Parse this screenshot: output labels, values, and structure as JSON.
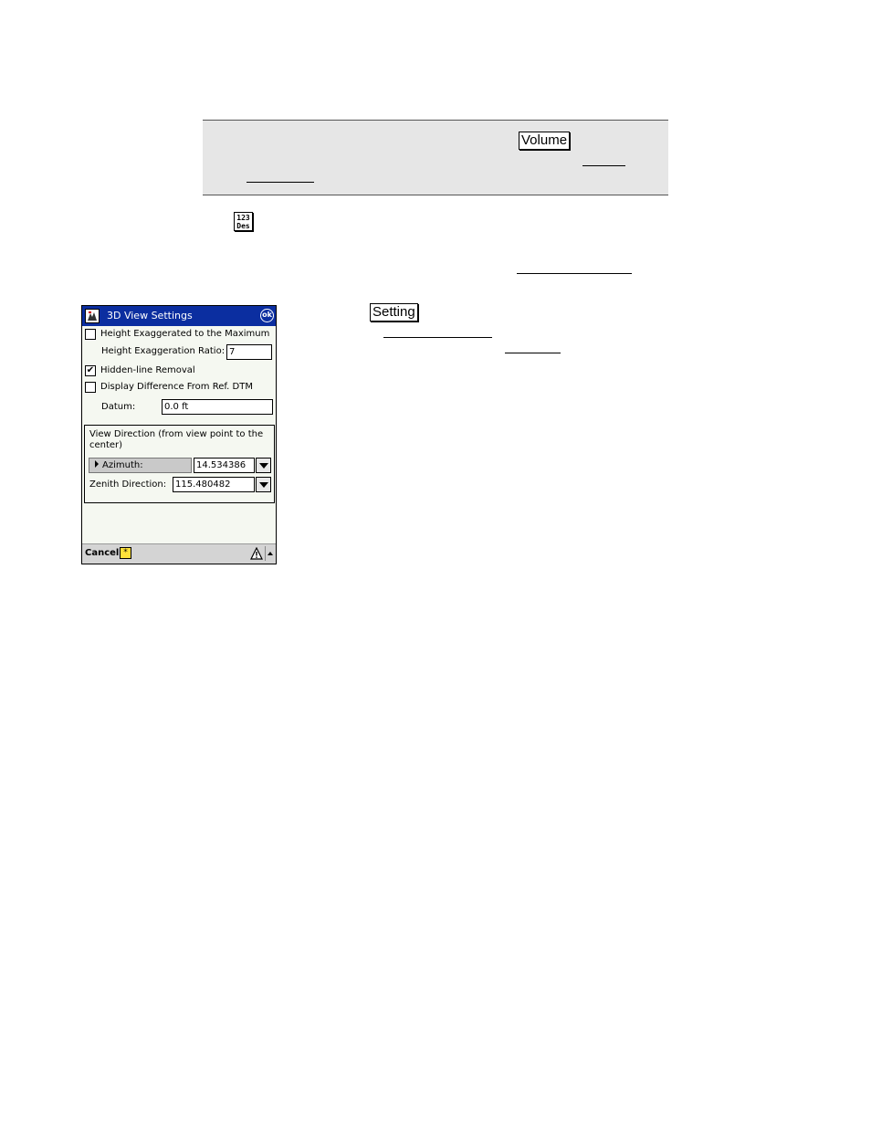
{
  "document": {
    "volume_button": "Volume",
    "calc_icon_line1": "123",
    "calc_icon_line2": "Des",
    "setting_button": "Setting"
  },
  "dialog": {
    "title": "3D View Settings",
    "ok_label": "ok",
    "height_max_label": "Height Exaggerated to the Maximum",
    "height_max_checked": false,
    "ratio_label": "Height Exaggeration Ratio:",
    "ratio_value": "7",
    "hidden_line_label": "Hidden-line Removal",
    "hidden_line_checked": true,
    "diff_label": "Display Difference From Ref. DTM",
    "diff_checked": false,
    "datum_label": "Datum:",
    "datum_value": "0.0 ft",
    "group_title": "View Direction (from view point to the center)",
    "azimuth_label": "Azimuth:",
    "azimuth_value": "14.534386",
    "zenith_label": "Zenith Direction:",
    "zenith_value": "115.480482",
    "cancel_label": "Cancel",
    "check_mark": "✔",
    "star_glyph": "*"
  }
}
